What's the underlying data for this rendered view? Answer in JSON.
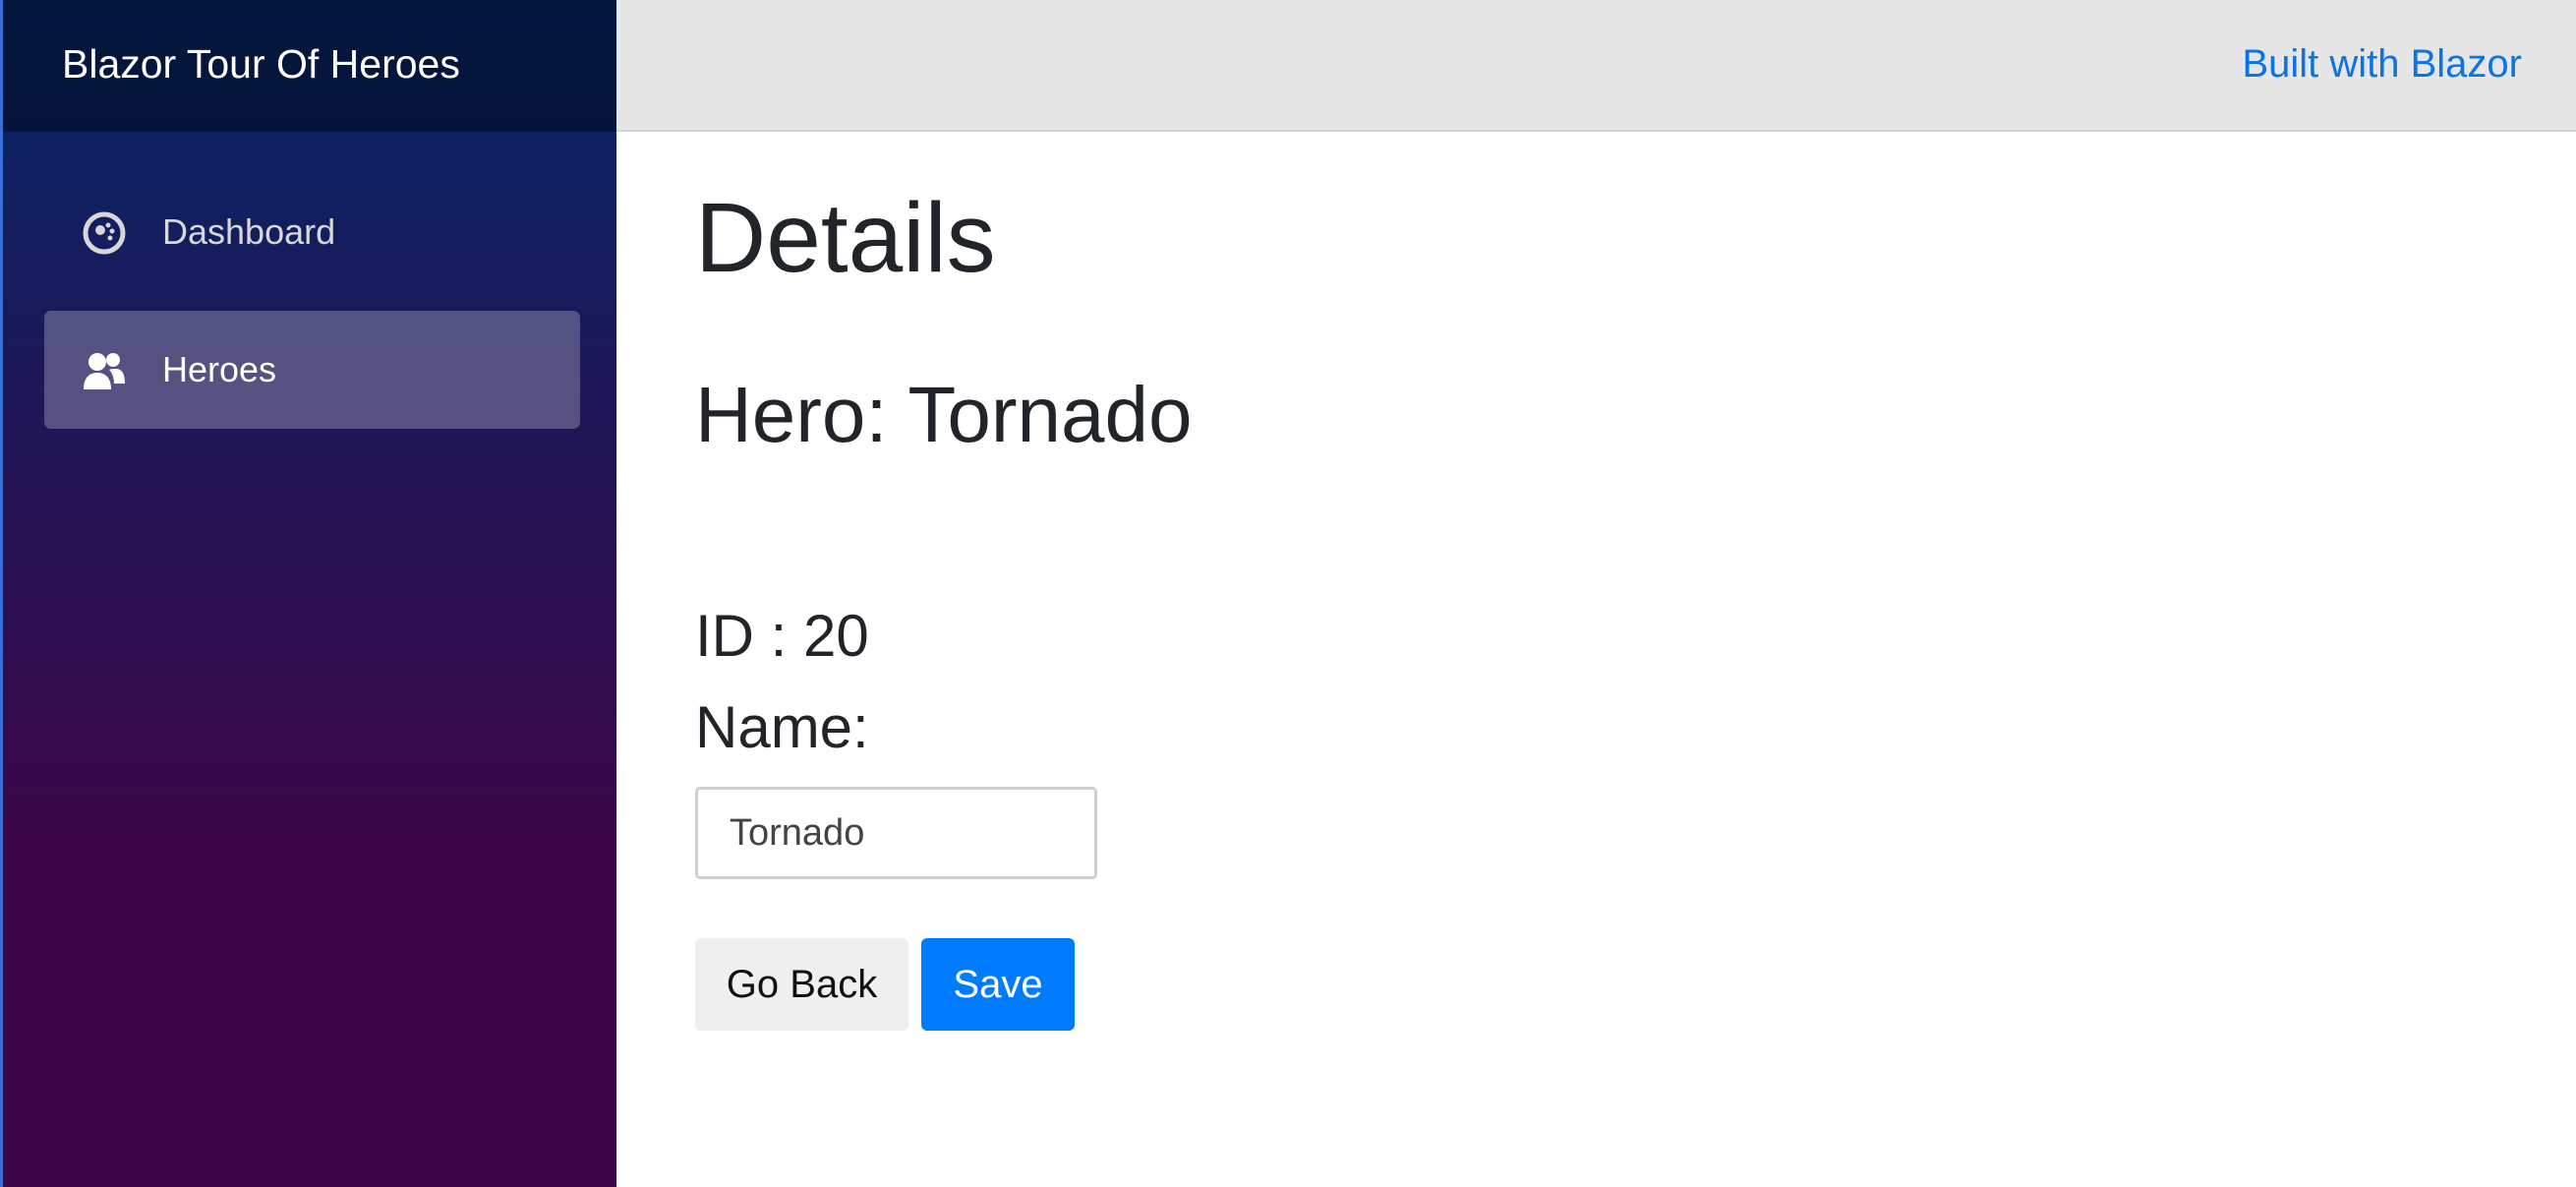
{
  "sidebar": {
    "brand": "Blazor Tour Of Heroes",
    "items": [
      {
        "label": "Dashboard",
        "icon": "dashboard-icon",
        "active": false
      },
      {
        "label": "Heroes",
        "icon": "people-icon",
        "active": true
      }
    ]
  },
  "topbar": {
    "about_link": "Built with Blazor"
  },
  "main": {
    "page_title": "Details",
    "hero_heading": "Hero: Tornado",
    "id_line": "ID : 20",
    "name_label": "Name:",
    "name_value": "Tornado",
    "go_back_label": "Go Back",
    "save_label": "Save"
  },
  "colors": {
    "sidebar_top": "#052767",
    "sidebar_bottom": "#3a0647",
    "link": "#0a73e8",
    "primary": "#007bff"
  }
}
